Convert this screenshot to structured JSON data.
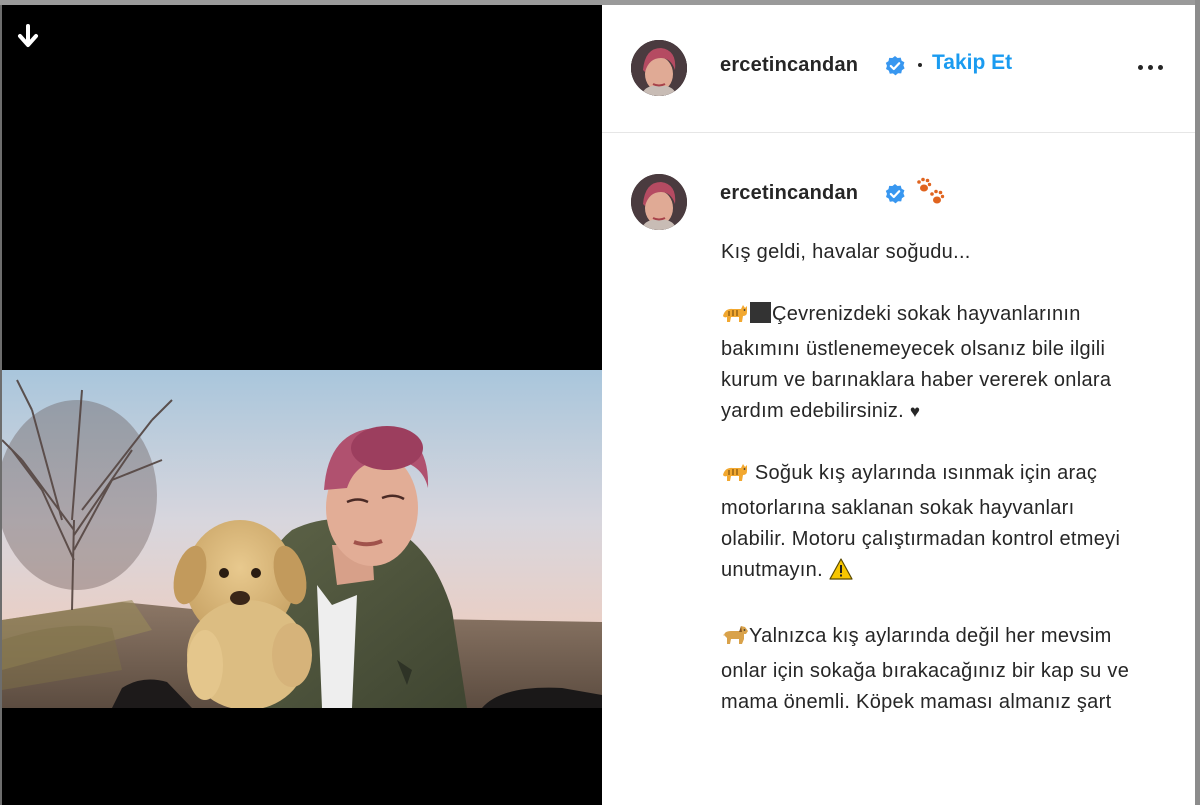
{
  "post": {
    "username": "ercetincandan",
    "follow_label": "Takip Et"
  },
  "caption": {
    "username": "ercetincandan",
    "p1": "Kış geldi, havalar soğudu...",
    "p2_text": "Çevrenizdeki sokak hayvanlarının bakımını üstlenemeyecek olsanız bile ilgili kurum ve barınaklara haber vererek onlara yardım edebilirsiniz.",
    "p2_heart": "♥",
    "p3_text": "Soğuk kış aylarında ısınmak için araç motorlarına saklanan sokak hayvanları olabilir. Motoru çalıştırmadan kontrol etmeyi unutmayın.",
    "p4_text": "Yalnızca kış aylarında değil her mevsim onlar için sokağa bırakacağınız bir kap su ve mama önemli. Köpek maması almanız şart"
  },
  "icons": {
    "download": "arrow-down-icon",
    "verified": "verified-badge-icon",
    "more": "more-options-icon",
    "paws": "paw-prints-icon",
    "cat": "cat-emoji",
    "dog": "dog-emoji",
    "warning": "warning-emoji"
  },
  "colors": {
    "follow_blue": "#1a9bf0",
    "verified_blue": "#3897f0",
    "text": "#262626"
  }
}
